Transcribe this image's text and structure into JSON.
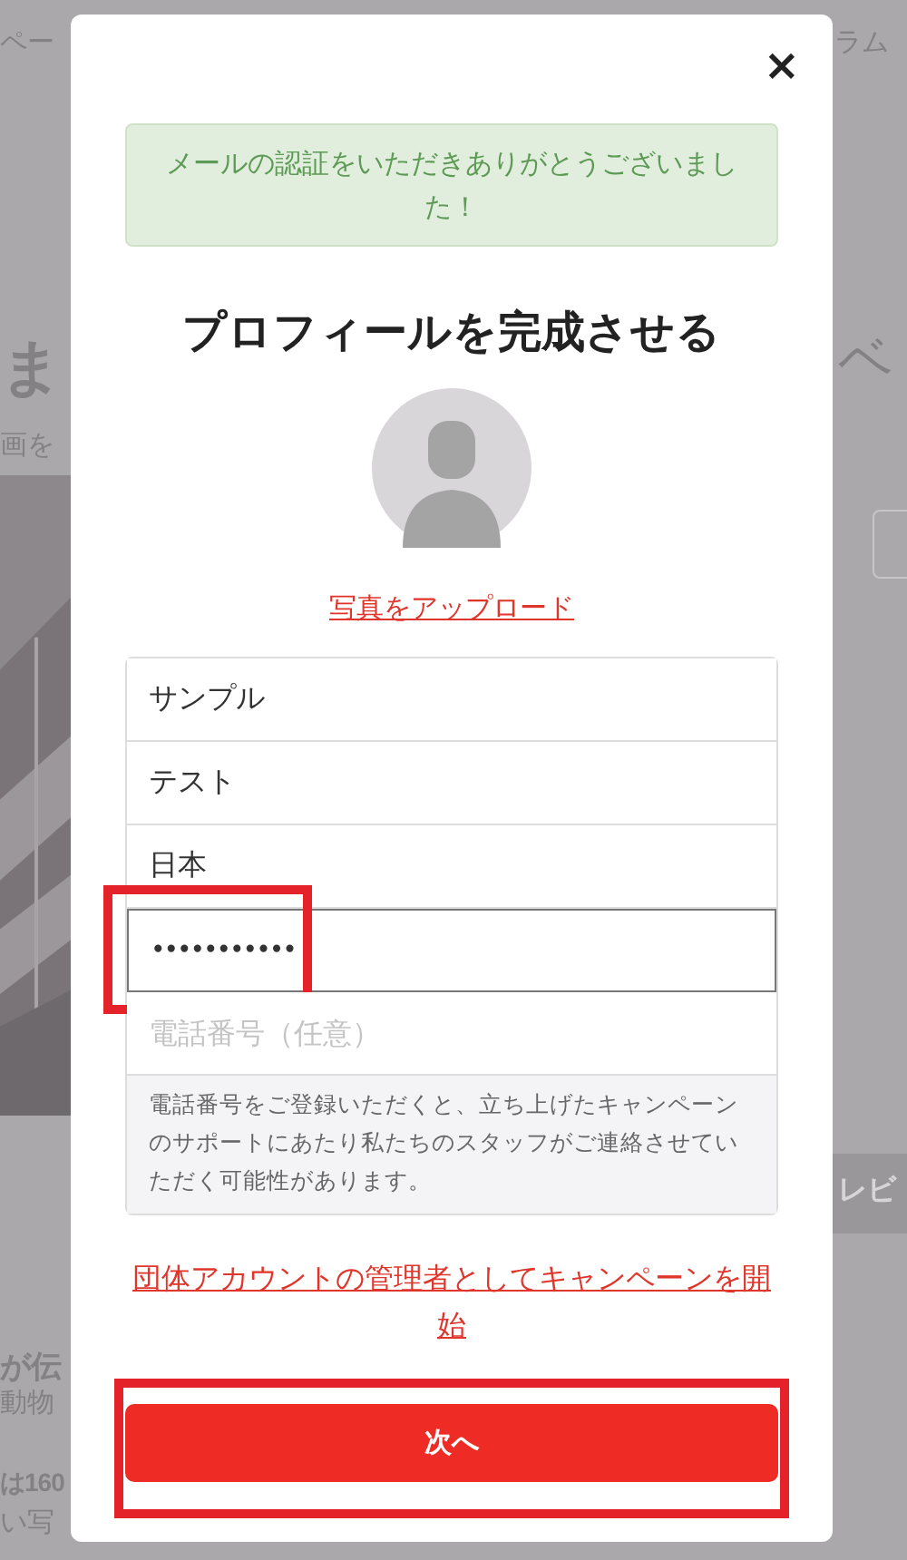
{
  "background_page": {
    "texts": [
      {
        "kind": "nav",
        "text": "ペー"
      },
      {
        "kind": "nav-right",
        "text": "ラム"
      },
      {
        "kind": "heading",
        "text": "ま"
      },
      {
        "kind": "heading-right",
        "text": "ベ"
      },
      {
        "kind": "sub",
        "text": "画を"
      },
      {
        "kind": "tag",
        "text": "レビ"
      },
      {
        "kind": "bold1",
        "text": "が伝"
      },
      {
        "kind": "line1",
        "text": "動物"
      },
      {
        "kind": "bold2",
        "text": "は160"
      },
      {
        "kind": "line2",
        "text": "い写"
      }
    ]
  },
  "modal": {
    "close": "×",
    "alert": "メールの認証をいただきありがとうございました！",
    "title": "プロフィールを完成させる",
    "upload_link": "写真をアップロード",
    "fields": [
      {
        "kind": "text",
        "value": "サンプル",
        "focused": false,
        "highlighted": false
      },
      {
        "kind": "text",
        "value": "テスト",
        "focused": false,
        "highlighted": false
      },
      {
        "kind": "text",
        "value": "日本",
        "focused": false,
        "highlighted": false
      },
      {
        "kind": "password",
        "value": "•••••••••••",
        "focused": true,
        "highlighted": true
      },
      {
        "kind": "text",
        "placeholder": "電話番号（任意）",
        "focused": false,
        "highlighted": false
      }
    ],
    "note": "電話番号をご登録いただくと、立ち上げたキャンペーンのサポートにあたり私たちのスタッフがご連絡させていただく可能性があります。",
    "org_link": "団体アカウントの管理者としてキャンペーンを開始",
    "next_button": {
      "label": "次へ",
      "highlighted": true
    }
  }
}
